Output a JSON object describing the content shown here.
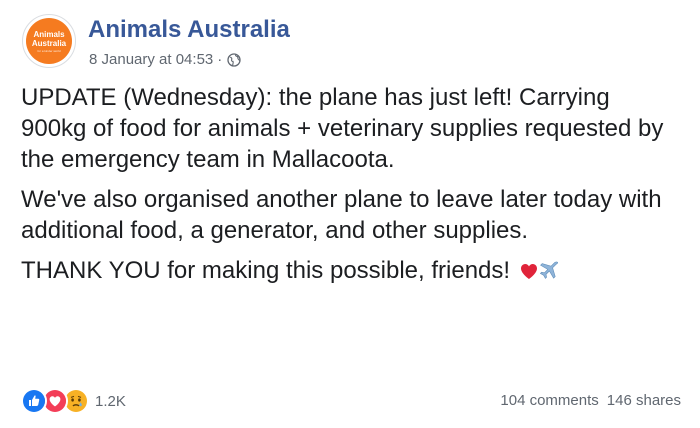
{
  "post": {
    "page_name": "Animals Australia",
    "avatar": {
      "line1": "Animals",
      "line2": "Australia",
      "line3": "for a kinder world",
      "color": "#f57b20"
    },
    "timestamp": "8 January at 04:53",
    "separator": "·",
    "privacy_icon": "globe-icon",
    "paragraphs": [
      "UPDATE (Wednesday): the plane has just left! Carrying 900kg of food for animals + veterinary supplies requested by the emergency team in Mallacoota.",
      "We've also organised another plane to leave later today with additional food, a generator, and other supplies.",
      "THANK YOU for making this possible, friends!"
    ],
    "closing_emoji": [
      "red-heart-icon",
      "airplane-icon"
    ]
  },
  "footer": {
    "reactions": [
      "like-icon",
      "love-icon",
      "sad-icon"
    ],
    "reaction_count": "1.2K",
    "comments": "104 comments",
    "shares": "146 shares"
  },
  "colors": {
    "name_link": "#385898",
    "meta_gray": "#606770",
    "text": "#1c1e21",
    "like_blue": "#1877f2",
    "love_red": "#f33e58",
    "sad_yellow": "#f7b125"
  }
}
